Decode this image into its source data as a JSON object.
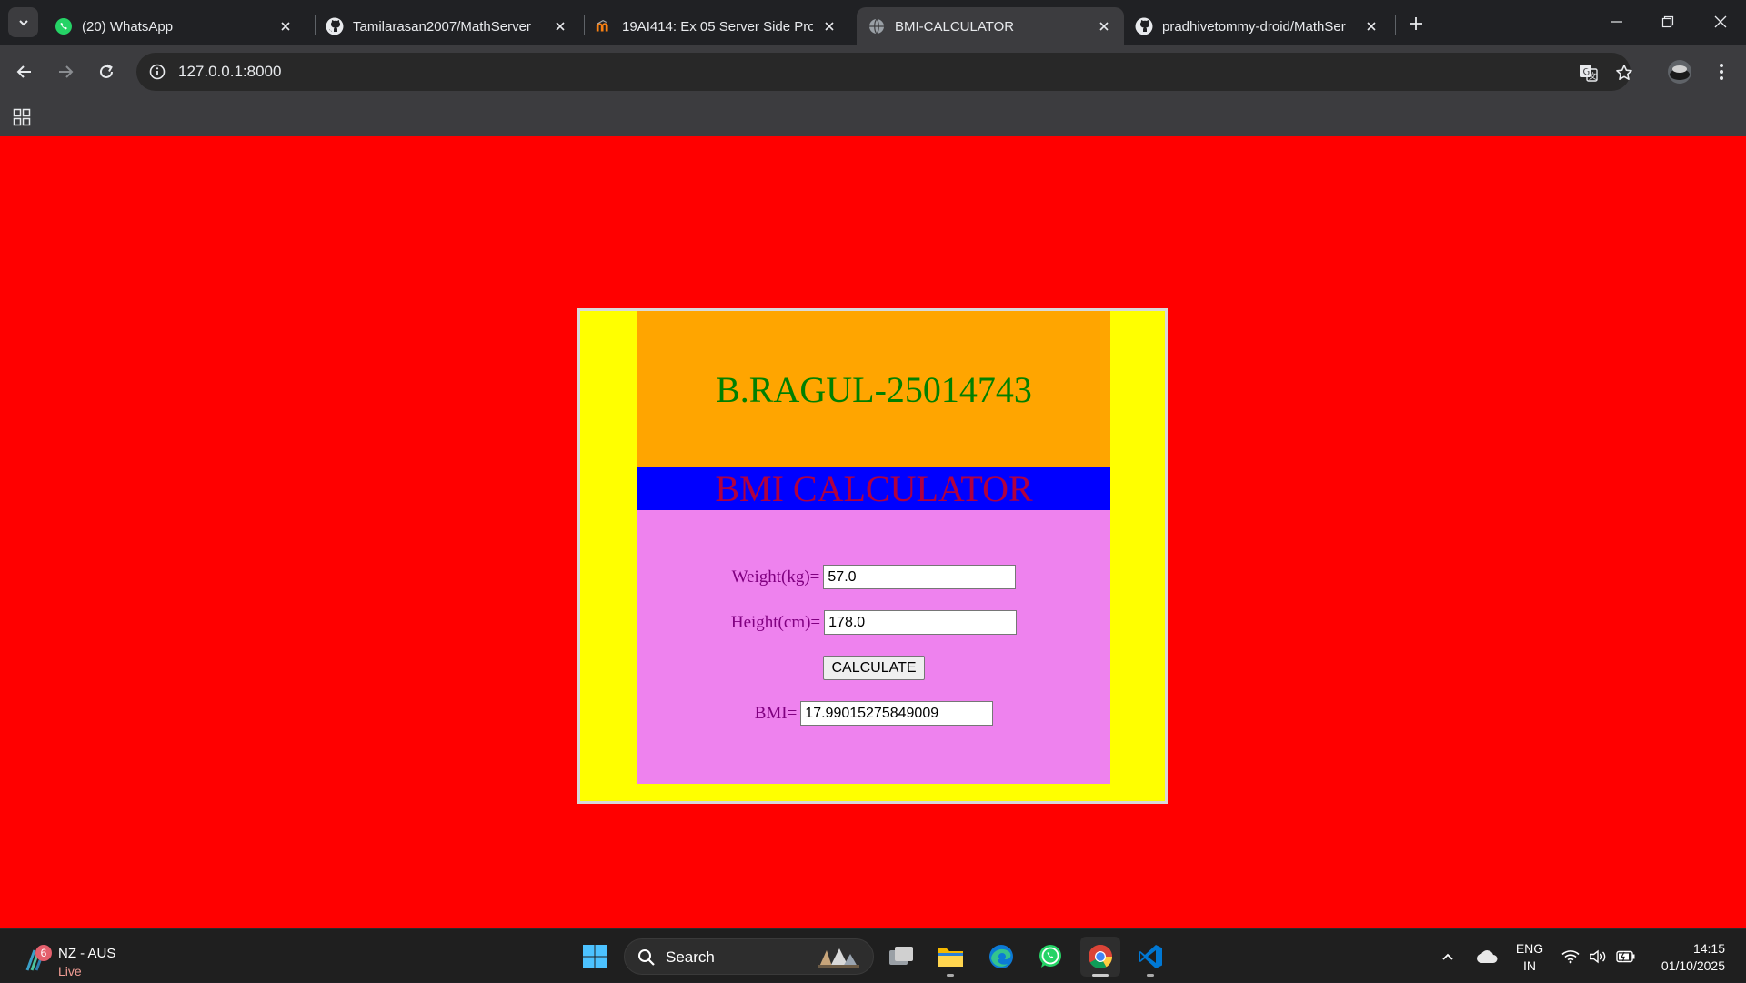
{
  "browser": {
    "tabs": [
      {
        "title": "(20) WhatsApp",
        "icon": "whatsapp-icon"
      },
      {
        "title": "Tamilarasan2007/MathServer",
        "icon": "github-icon"
      },
      {
        "title": "19AI414: Ex 05 Server Side Proc",
        "icon": "moodle-icon"
      },
      {
        "title": "BMI-CALCULATOR",
        "icon": "globe-icon",
        "active": true
      },
      {
        "title": "pradhivetommy-droid/MathSer",
        "icon": "github-icon"
      }
    ],
    "url": "127.0.0.1:8000"
  },
  "page": {
    "heading": "B.RAGUL-25014743",
    "title": "BMI CALCULATOR",
    "weight_label": "Weight(kg)=",
    "weight_value": "57.0",
    "height_label": "Height(cm)=",
    "height_value": "178.0",
    "calculate_label": "CALCULATE",
    "bmi_label": "BMI=",
    "bmi_value": "17.99015275849009",
    "colors": {
      "background": "#ff0000",
      "container": "#ffff00",
      "header": "#ffa500",
      "title_band": "#0000ff",
      "form": "#ee82ee",
      "heading_text": "#008000",
      "title_text": "#b00040",
      "label_text": "#800080"
    }
  },
  "taskbar": {
    "weather_badge": "6",
    "weather_title": "NZ - AUS",
    "weather_sub": "Live",
    "search_label": "Search",
    "lang_line1": "ENG",
    "lang_line2": "IN",
    "time": "14:15",
    "date": "01/10/2025"
  }
}
